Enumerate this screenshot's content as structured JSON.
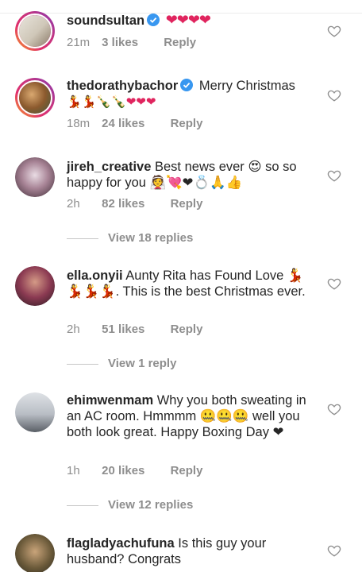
{
  "comments": [
    {
      "username": "soundsultan",
      "verified": true,
      "text": "",
      "emojis": "❤❤❤❤",
      "time": "21m",
      "likes": "3 likes",
      "reply": "Reply",
      "avatar_color": "#d8d2c6",
      "story_ring": true
    },
    {
      "username": "thedorathybachor",
      "verified": true,
      "text": "Merry Christmas",
      "emojis": "💃💃🍾🍾❤❤❤",
      "time": "18m",
      "likes": "24 likes",
      "reply": "Reply",
      "avatar_color": "#b78a5e",
      "story_ring": true
    },
    {
      "username": "jireh_creative",
      "verified": false,
      "text": "Best news ever 😍 so so happy for you 👰💘❤💍🙏👍",
      "time": "2h",
      "likes": "82 likes",
      "reply": "Reply",
      "view_replies": "View 18 replies",
      "avatar_color": "#9c7a8c",
      "story_ring": false
    },
    {
      "username": "ella.onyii",
      "verified": false,
      "text": "Aunty Rita has Found Love 💃💃💃💃. This is the best Christmas ever.",
      "time": "2h",
      "likes": "51 likes",
      "reply": "Reply",
      "view_replies": "View 1 reply",
      "avatar_color": "#7a3b4a",
      "story_ring": false
    },
    {
      "username": "ehimwenmam",
      "verified": false,
      "text": "Why you both sweating in an AC room. Hmmmm 🤐🤐🤐 well you both look great. Happy Boxing Day ❤",
      "time": "1h",
      "likes": "20 likes",
      "reply": "Reply",
      "view_replies": "View 12 replies",
      "avatar_color": "#c9ccd1",
      "story_ring": false
    },
    {
      "username": "flagladyachufuna",
      "verified": false,
      "text": "Is this guy your husband? Congrats",
      "avatar_color": "#6b5a3a",
      "story_ring": false
    }
  ],
  "colors": {
    "text": "#262626",
    "meta": "#8e8e8e",
    "verified": "#3897f0",
    "heart": "#e0245e"
  },
  "icons": {
    "like": "heart-outline-icon",
    "verified": "verified-badge-icon"
  }
}
